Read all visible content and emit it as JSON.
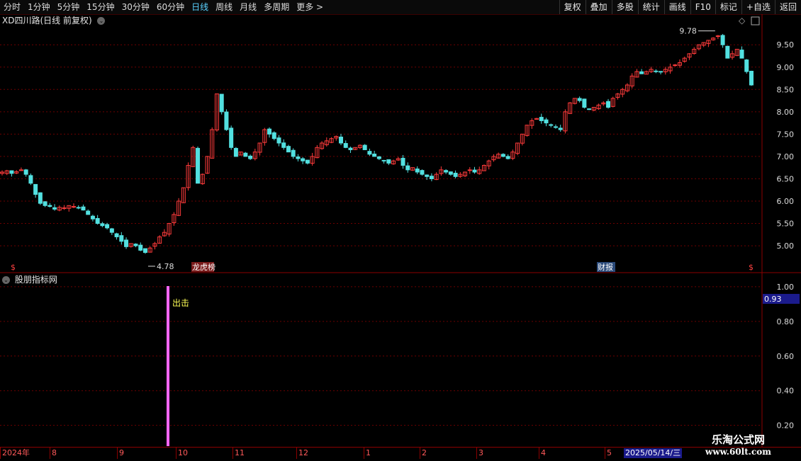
{
  "toolbar": {
    "periods": [
      "分时",
      "1分钟",
      "5分钟",
      "15分钟",
      "30分钟",
      "60分钟",
      "日线",
      "周线",
      "月线",
      "多周期",
      "更多"
    ],
    "active_period": "日线",
    "right_buttons": [
      "复权",
      "叠加",
      "多股",
      "统计",
      "画线",
      "F10",
      "标记",
      "+自选",
      "返回"
    ]
  },
  "main_chart": {
    "title": "XD四川路(日线 前复权)",
    "high_label": "9.78",
    "low_label": "4.78",
    "y_ticks": [
      "9.50",
      "9.00",
      "8.50",
      "8.00",
      "7.50",
      "7.00",
      "6.50",
      "6.00",
      "5.50",
      "5.00"
    ],
    "markers": [
      "龙虎榜",
      "财报",
      "$",
      "$"
    ],
    "colors": {
      "up": "#ff3b3b",
      "down": "#52e0e0",
      "grid": "#6e0000",
      "axis": "#8b0000"
    }
  },
  "sub_chart": {
    "title": "股朋指标网",
    "current_value": "0.93",
    "y_ticks": [
      "1.00",
      "0.80",
      "0.60",
      "0.40",
      "0.20"
    ],
    "signal_label": "出击",
    "signal_color": "#ff66ff"
  },
  "time_axis": {
    "labels": [
      "2024年",
      "8",
      "9",
      "10",
      "11",
      "12",
      "1",
      "2",
      "3",
      "4",
      "5"
    ],
    "cursor_date": "2025/05/14/三"
  },
  "watermark": {
    "line1": "乐淘公式网",
    "line2": "www.60lt.com"
  },
  "chart_data": {
    "type": "candlestick",
    "title": "XD四川路(日线 前复权)",
    "x_months": [
      "2024-07",
      "2024-08",
      "2024-09",
      "2024-10",
      "2024-11",
      "2024-12",
      "2025-01",
      "2025-02",
      "2025-03",
      "2025-04",
      "2025-05"
    ],
    "ylim": [
      4.7,
      9.9
    ],
    "y_ticks": [
      5.0,
      5.5,
      6.0,
      6.5,
      7.0,
      7.5,
      8.0,
      8.5,
      9.0,
      9.5
    ],
    "annotated_high": 9.78,
    "annotated_low": 4.78,
    "close_path": [
      6.65,
      6.68,
      6.62,
      6.66,
      6.7,
      6.6,
      6.4,
      6.15,
      5.95,
      5.9,
      5.88,
      5.82,
      5.86,
      5.85,
      5.9,
      5.88,
      5.85,
      5.8,
      5.7,
      5.6,
      5.5,
      5.45,
      5.4,
      5.3,
      5.2,
      5.1,
      4.98,
      5.05,
      5.0,
      4.9,
      4.85,
      4.95,
      5.05,
      5.2,
      5.3,
      5.5,
      5.7,
      6.0,
      6.3,
      6.8,
      7.2,
      6.4,
      6.6,
      7.0,
      7.6,
      8.4,
      8.0,
      7.6,
      7.2,
      7.0,
      7.1,
      7.0,
      6.95,
      7.1,
      7.3,
      7.6,
      7.5,
      7.4,
      7.3,
      7.2,
      7.1,
      7.0,
      6.95,
      6.9,
      6.85,
      7.0,
      7.2,
      7.3,
      7.35,
      7.4,
      7.45,
      7.3,
      7.2,
      7.15,
      7.2,
      7.25,
      7.15,
      7.05,
      7.0,
      6.95,
      6.9,
      6.85,
      6.9,
      6.95,
      6.8,
      6.7,
      6.75,
      6.65,
      6.6,
      6.55,
      6.5,
      6.6,
      6.7,
      6.65,
      6.6,
      6.55,
      6.6,
      6.65,
      6.7,
      6.65,
      6.7,
      6.8,
      6.9,
      7.0,
      7.05,
      7.0,
      6.95,
      7.1,
      7.3,
      7.5,
      7.7,
      7.8,
      7.85,
      7.8,
      7.75,
      7.7,
      7.65,
      7.6,
      8.0,
      8.2,
      8.3,
      8.25,
      8.1,
      8.05,
      8.1,
      8.15,
      8.2,
      8.1,
      8.3,
      8.4,
      8.5,
      8.6,
      8.8,
      8.9,
      8.85,
      8.9,
      8.95,
      8.9,
      8.9,
      8.95,
      9.0,
      9.05,
      9.1,
      9.2,
      9.3,
      9.4,
      9.5,
      9.55,
      9.6,
      9.65,
      9.7,
      9.5,
      9.2,
      9.3,
      9.4,
      9.2,
      8.9,
      8.6
    ],
    "signal_month": "2024-09",
    "indicator_last": 0.93
  }
}
